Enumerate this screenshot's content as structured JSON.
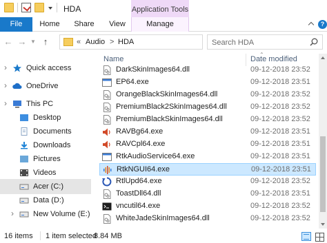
{
  "window": {
    "title": "HDA",
    "contextual_group": "Application Tools"
  },
  "ribbon": {
    "tabs": [
      {
        "label": "File"
      },
      {
        "label": "Home"
      },
      {
        "label": "Share"
      },
      {
        "label": "View"
      },
      {
        "label": "Manage"
      }
    ],
    "help_glyph": "?"
  },
  "address": {
    "chevron_root": "«",
    "crumbs": [
      "Audio",
      "HDA"
    ],
    "separator": ">"
  },
  "search": {
    "placeholder": "Search HDA"
  },
  "nav": {
    "items": [
      {
        "label": "Quick access",
        "icon": "star-icon",
        "color": "#1979ca"
      },
      {
        "label": "OneDrive",
        "icon": "cloud-icon",
        "color": "#1e6fc8"
      },
      {
        "label": "This PC",
        "icon": "computer-icon",
        "color": "#3a7bd5"
      },
      {
        "label": "Desktop",
        "icon": "desktop-folder-icon",
        "color": "#3d8ee0"
      },
      {
        "label": "Documents",
        "icon": "documents-folder-icon",
        "color": "#8aa4c4"
      },
      {
        "label": "Downloads",
        "icon": "downloads-folder-icon",
        "color": "#1d83d6"
      },
      {
        "label": "Pictures",
        "icon": "pictures-folder-icon",
        "color": "#6aa7d9"
      },
      {
        "label": "Videos",
        "icon": "videos-folder-icon",
        "color": "#4a4a4a"
      },
      {
        "label": "Acer (C:)",
        "icon": "drive-c-icon",
        "color": "#7a7a7a"
      },
      {
        "label": "Data (D:)",
        "icon": "drive-d-icon",
        "color": "#7a7a7a"
      },
      {
        "label": "New Volume (E:)",
        "icon": "drive-e-icon",
        "color": "#7a7a7a"
      }
    ],
    "selected_index": 8
  },
  "columns": {
    "name": "Name",
    "date": "Date modified"
  },
  "files": [
    {
      "name": "DarkSkinImages64.dll",
      "date": "09-12-2018 23:52",
      "icon": "dll-icon"
    },
    {
      "name": "EP64.exe",
      "date": "09-12-2018 23:51",
      "icon": "exe-icon"
    },
    {
      "name": "OrangeBlackSkinImages64.dll",
      "date": "09-12-2018 23:52",
      "icon": "dll-icon"
    },
    {
      "name": "PremiumBlack2SkinImages64.dll",
      "date": "09-12-2018 23:52",
      "icon": "dll-icon"
    },
    {
      "name": "PremiumBlackSkinImages64.dll",
      "date": "09-12-2018 23:52",
      "icon": "dll-icon"
    },
    {
      "name": "RAVBg64.exe",
      "date": "09-12-2018 23:51",
      "icon": "speaker-icon"
    },
    {
      "name": "RAVCpl64.exe",
      "date": "09-12-2018 23:51",
      "icon": "speaker-icon"
    },
    {
      "name": "RtkAudioService64.exe",
      "date": "09-12-2018 23:51",
      "icon": "exe-icon"
    },
    {
      "name": "RtkNGUI64.exe",
      "date": "09-12-2018 23:51",
      "icon": "audio-wave-icon"
    },
    {
      "name": "RtlUpd64.exe",
      "date": "09-12-2018 23:52",
      "icon": "update-icon"
    },
    {
      "name": "ToastDll64.dll",
      "date": "09-12-2018 23:51",
      "icon": "dll-icon"
    },
    {
      "name": "vncutil64.exe",
      "date": "09-12-2018 23:52",
      "icon": "console-icon"
    },
    {
      "name": "WhiteJadeSkinImages64.dll",
      "date": "09-12-2018 23:52",
      "icon": "dll-icon"
    }
  ],
  "selected_file_index": 8,
  "status": {
    "count": "16 items",
    "selection": "1 item selected",
    "size": "8.84 MB"
  },
  "colors": {
    "accent": "#1979ca",
    "context_tab": "#efd9f7",
    "selection_bg": "#cce8ff",
    "selection_border": "#99d1ff"
  }
}
